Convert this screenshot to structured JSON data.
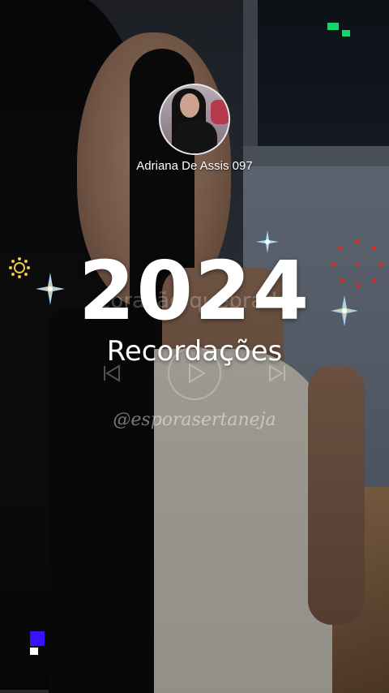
{
  "profile": {
    "name": "Adriana De Assis 097"
  },
  "title": {
    "year": "2024",
    "subtitle": "Recordações"
  },
  "player": {
    "song_text": "coração quebrado"
  },
  "watermark": "@esporasertaneja",
  "colors": {
    "accent_green": "#17d36b",
    "accent_blue": "#3b10ff",
    "sparkle_cyan": "#9fe3ff",
    "sparkle_gold": "#f3c44a",
    "dots_red": "#e5271f"
  },
  "icons": [
    "previous-icon",
    "play-icon",
    "next-icon",
    "sparkle-icon",
    "sun-icon",
    "firework-icon"
  ]
}
